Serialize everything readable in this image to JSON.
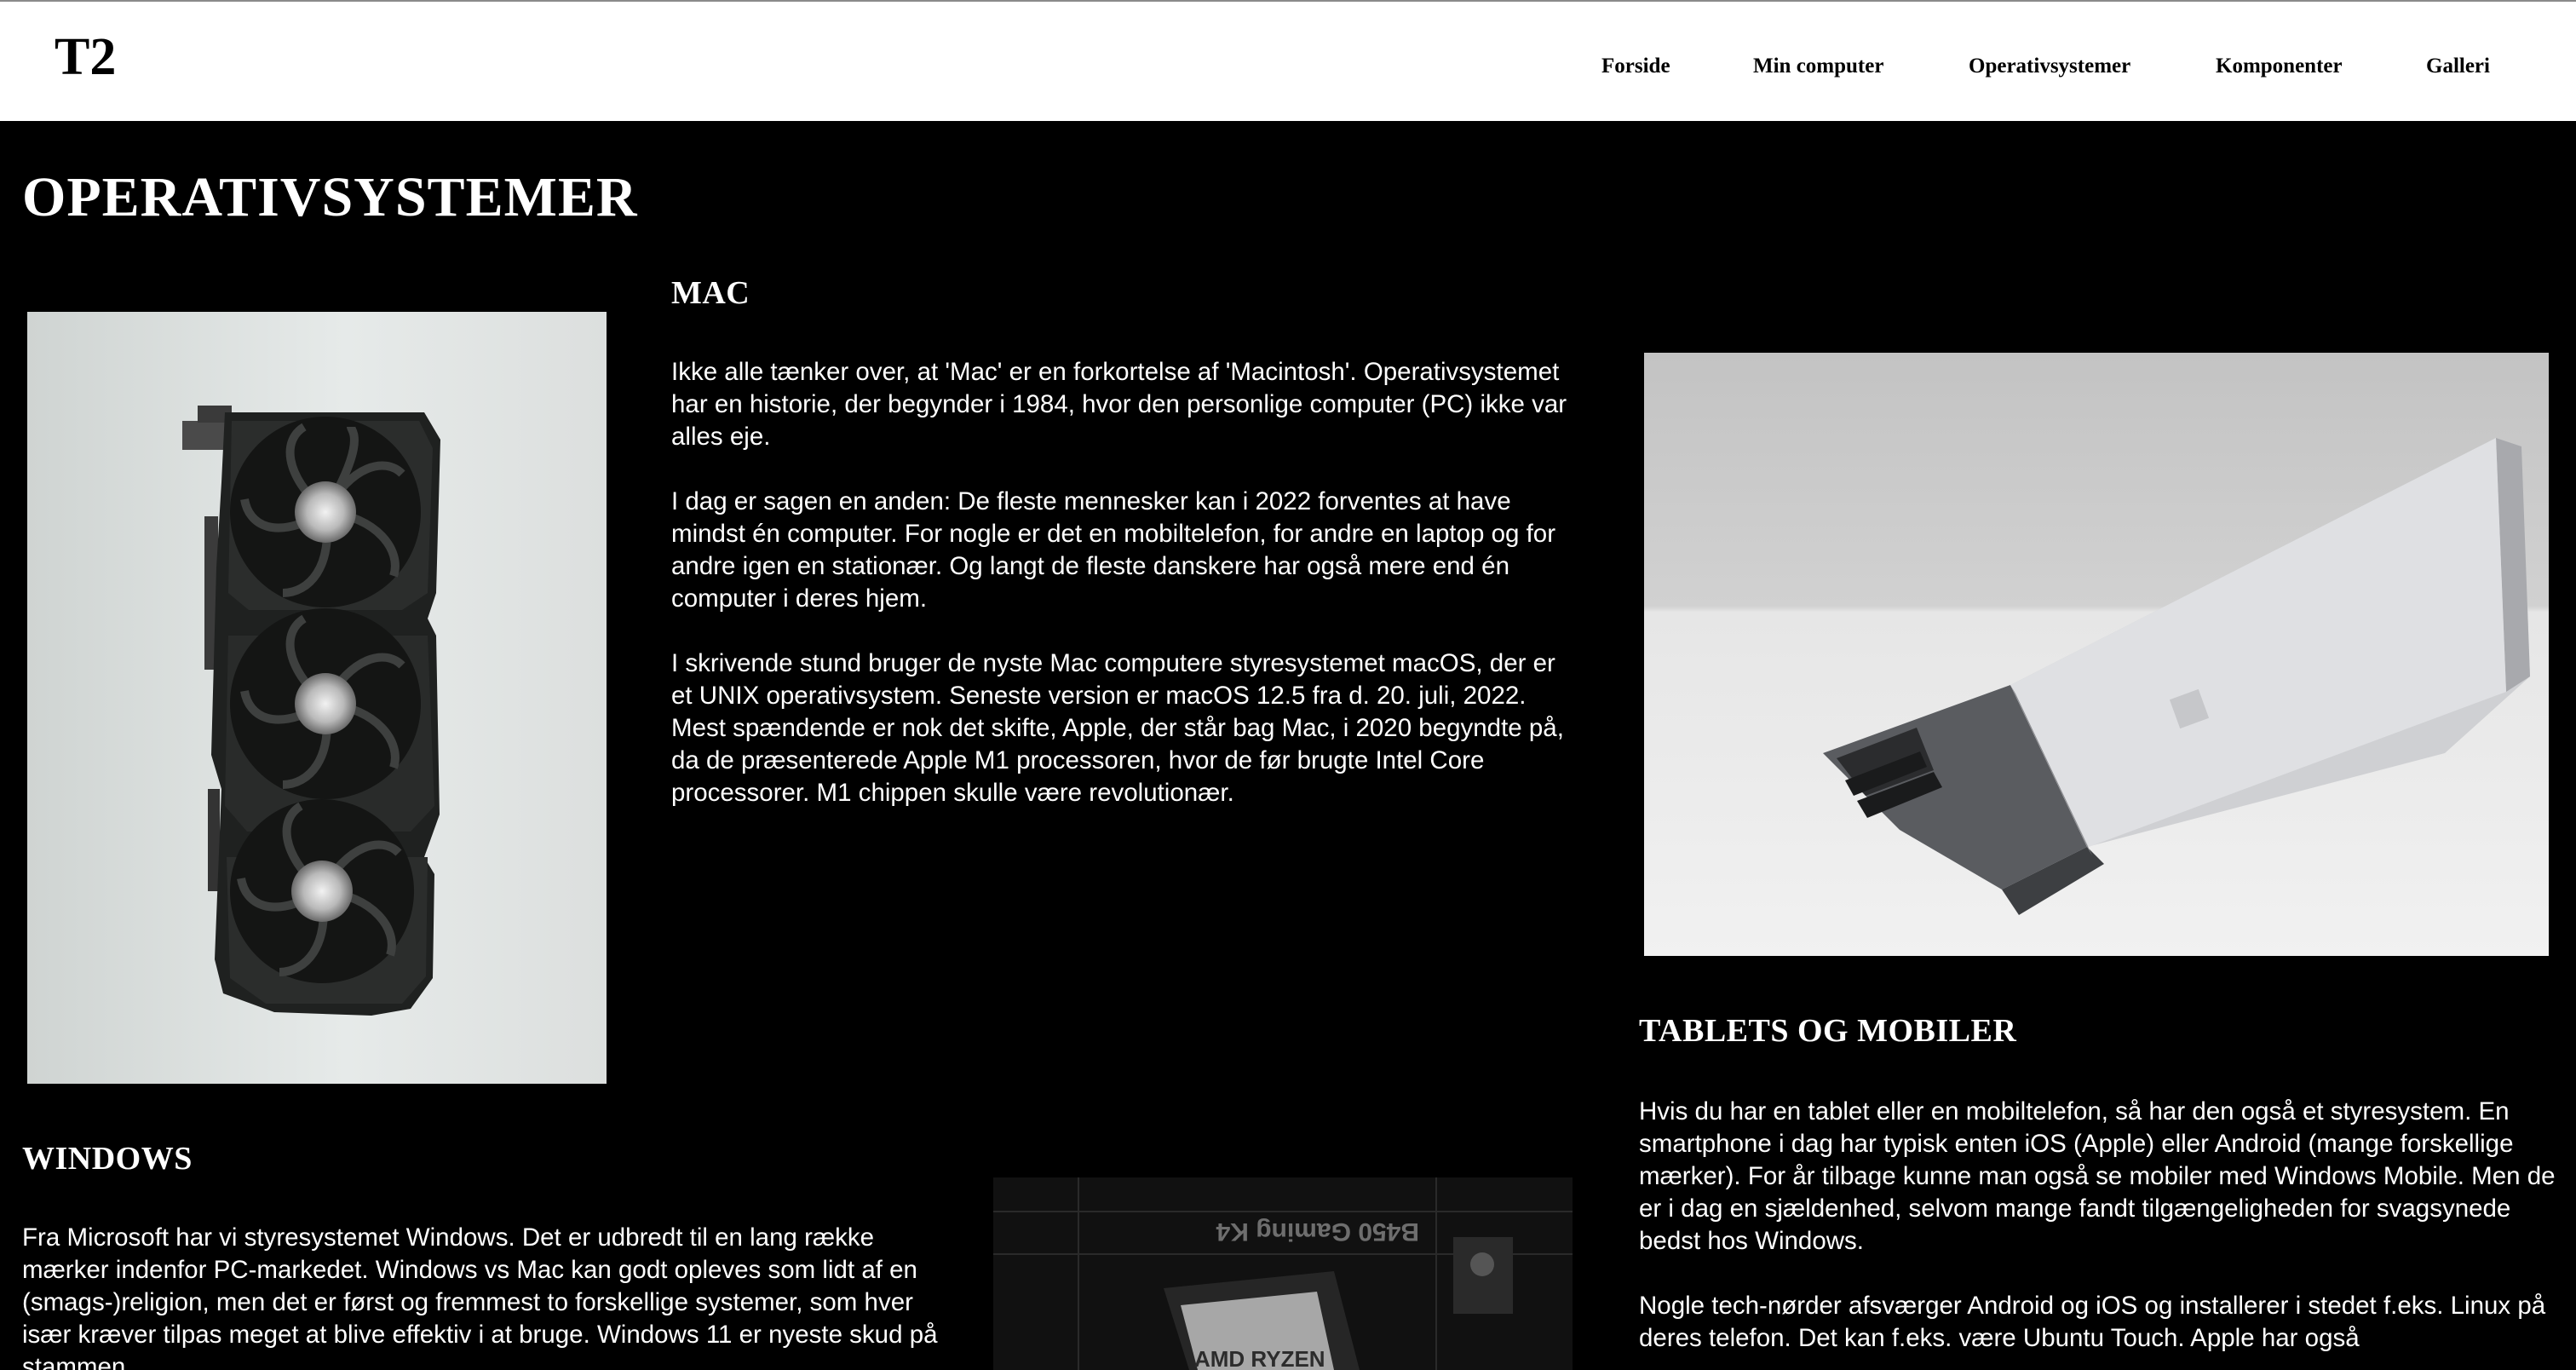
{
  "header": {
    "logo": "T2",
    "nav": [
      {
        "label": "Forside"
      },
      {
        "label": "Min computer"
      },
      {
        "label": "Operativsystemer"
      },
      {
        "label": "Komponenter"
      },
      {
        "label": "Galleri"
      }
    ]
  },
  "page": {
    "title": "OPERATIVSYSTEMER"
  },
  "mac": {
    "heading": "MAC",
    "paragraphs": [
      "Ikke alle tænker over, at 'Mac' er en forkortelse af 'Macintosh'. Operativsystemet har en historie, der begynder i 1984, hvor den personlige computer (PC) ikke var alles eje.",
      "I dag er sagen en anden: De fleste mennesker kan i 2022 forventes at have mindst én computer. For nogle er det en mobiltelefon, for andre en laptop og for andre igen en stationær. Og langt de fleste danskere har også mere end én computer i deres hjem.",
      "I skrivende stund bruger de nyste Mac computere styresystemet macOS, der er et UNIX operativsystem. Seneste version er macOS 12.5 fra d. 20. juli, 2022. Mest spændende er nok det skifte, Apple, der står bag Mac, i 2020 begyndte på, da de præsenterede Apple M1 processoren, hvor de før brugte Intel Core processorer. M1 chippen skulle være revolutionær."
    ]
  },
  "windows": {
    "heading": "WINDOWS",
    "paragraphs": [
      "Fra Microsoft har vi styresystemet Windows. Det er udbredt til en lang række mærker indenfor PC-markedet. Windows vs Mac kan godt opleves som lidt af en (smags-)religion, men det er først og fremmest to forskellige systemer, som hver især kræver tilpas meget at blive effektiv i at bruge. Windows 11 er nyeste skud på stammen."
    ]
  },
  "tablets": {
    "heading": "TABLETS OG MOBILER",
    "paragraphs": [
      "Hvis du har en tablet eller en mobiltelefon, så har den også et styresystem. En smartphone i dag har typisk enten iOS (Apple) eller Android (mange forskellige mærker). For år tilbage kunne man også se mobiler med Windows Mobile. Men de er i dag en sjældenhed, selvom mange fandt tilgængeligheden for svagsynede bedst hos Windows.",
      "Nogle tech-nørder afsværger Android og iOS og installerer i stedet f.eks. Linux på deres telefon. Det kan f.eks. være Ubuntu Touch. Apple har også"
    ]
  },
  "images": {
    "mobo_text_1": "B450 Gaming K4",
    "mobo_text_2": "AMD RYZEN"
  }
}
